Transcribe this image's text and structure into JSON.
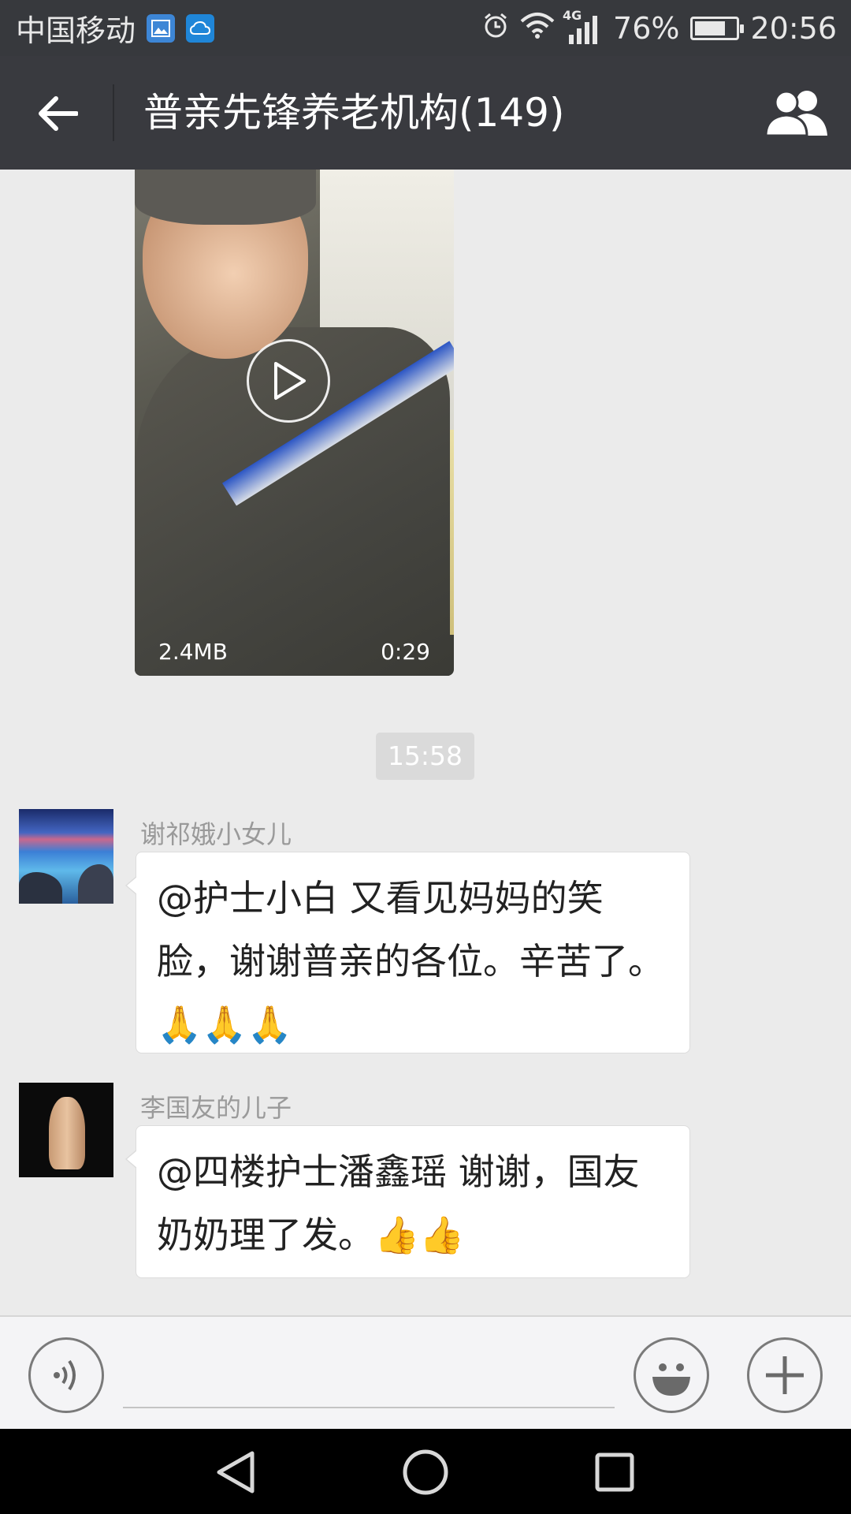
{
  "status_bar": {
    "carrier": "中国移动",
    "network": "4G",
    "battery_text": "76%",
    "battery_level": 0.76,
    "time": "20:56"
  },
  "header": {
    "title": "普亲先锋养老机构(149)"
  },
  "video": {
    "size": "2.4MB",
    "duration": "0:29"
  },
  "timestamp": "15:58",
  "messages": [
    {
      "sender": "谢祁娥小女儿",
      "text": "@护士小白 又看见妈妈的笑脸，谢谢普亲的各位。辛苦了。🙏🙏🙏"
    },
    {
      "sender": "李国友的儿子",
      "text": "@四楼护士潘鑫瑶  谢谢，国友奶奶理了发。👍👍"
    }
  ],
  "input": {
    "value": "",
    "placeholder": ""
  },
  "colors": {
    "status_bar_bg": "#37393d",
    "title_bar_bg": "#393a3f",
    "chat_bg": "#ebebeb"
  },
  "icons": {
    "back": "arrow-left-icon",
    "group": "group-members-icon",
    "play": "play-icon",
    "voice": "voice-icon",
    "emoji": "emoji-icon",
    "plus": "plus-icon"
  }
}
